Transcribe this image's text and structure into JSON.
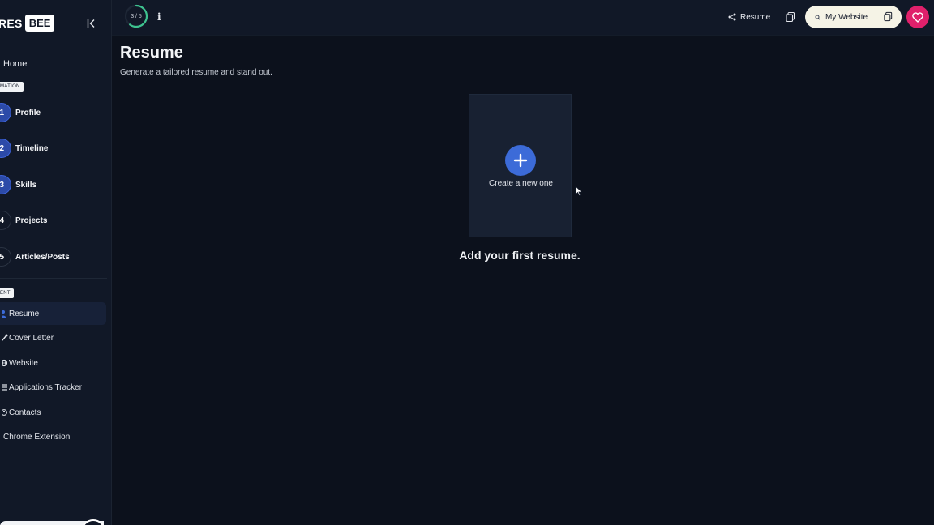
{
  "sidebar": {
    "logo": {
      "left": "RES",
      "right": "BEE"
    },
    "home_label": "Home",
    "section_information": "MATION",
    "steps": [
      {
        "number": "1",
        "label": "Profile",
        "done": true
      },
      {
        "number": "2",
        "label": "Timeline",
        "done": true
      },
      {
        "number": "3",
        "label": "Skills",
        "done": true
      },
      {
        "number": "4",
        "label": "Projects",
        "done": false
      },
      {
        "number": "5",
        "label": "Articles/Posts",
        "done": false
      }
    ],
    "section_content": "ENT",
    "nav": [
      {
        "label": "Resume",
        "icon": "user-icon",
        "active": true
      },
      {
        "label": "Cover Letter",
        "icon": "pen-icon",
        "active": false
      },
      {
        "label": "Website",
        "icon": "globe-icon",
        "active": false
      },
      {
        "label": "Applications Tracker",
        "icon": "list-icon",
        "active": false
      },
      {
        "label": "Contacts",
        "icon": "contact-icon",
        "active": false
      },
      {
        "label": "Chrome Extension",
        "icon": "chrome-icon",
        "active": false
      }
    ]
  },
  "header": {
    "progress_text": "3 / 5",
    "progress": {
      "current": 3,
      "total": 5
    },
    "info_icon": "i",
    "share_label": "Resume",
    "website_label": "My Website"
  },
  "main": {
    "title": "Resume",
    "subtitle": "Generate a tailored resume and stand out.",
    "create_label": "Create a new one",
    "empty_message": "Add your first resume."
  },
  "colors": {
    "accent": "#3c6bd8",
    "heart": "#e0206b",
    "progress": "#3ec28f"
  }
}
